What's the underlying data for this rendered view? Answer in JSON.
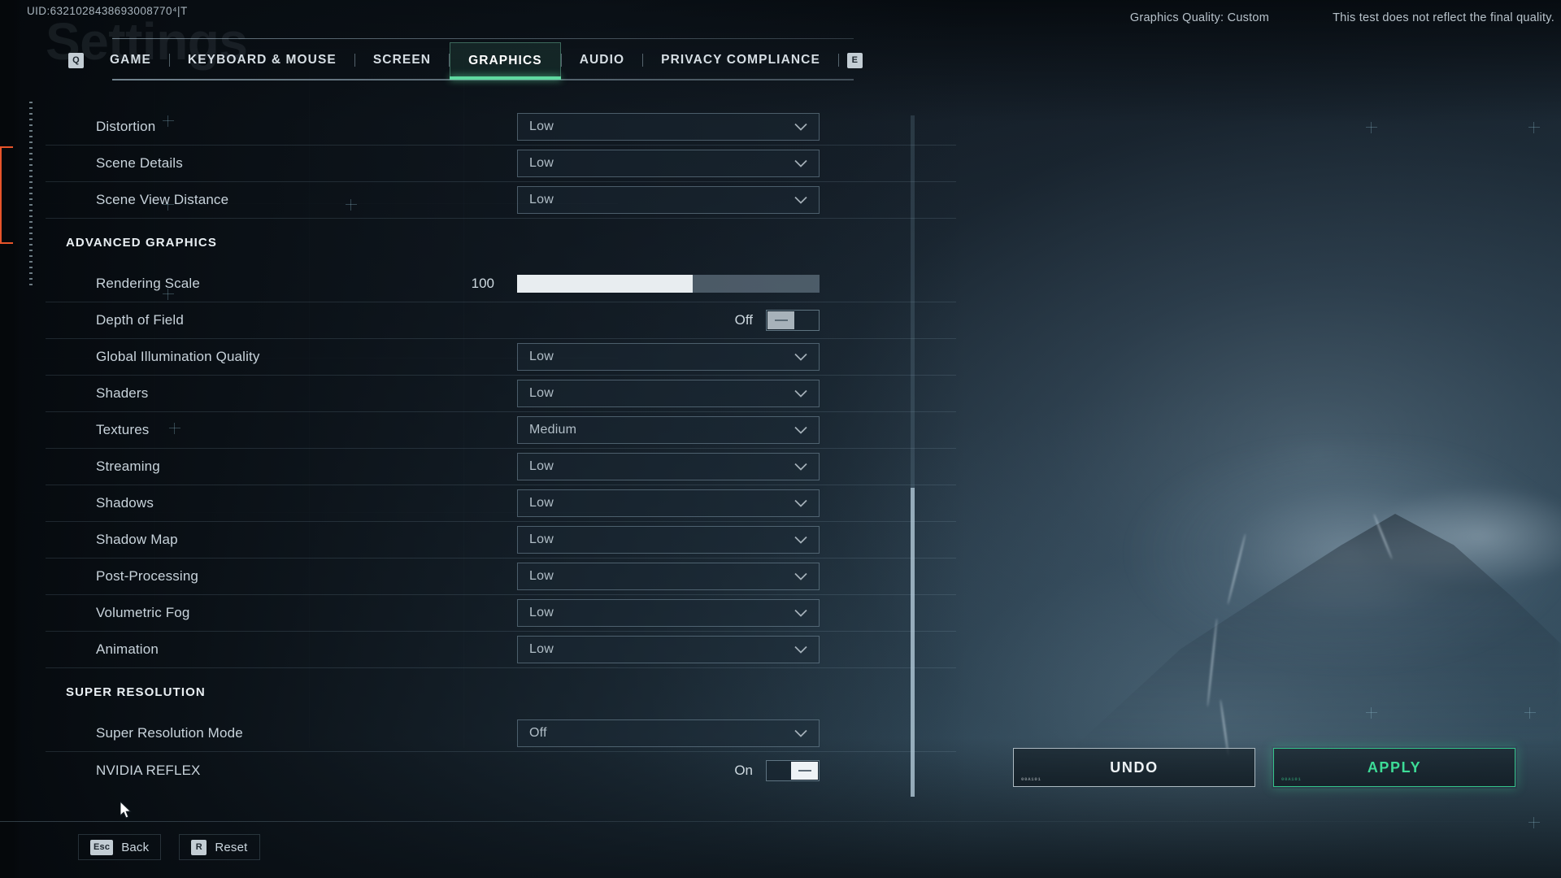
{
  "header": {
    "uid": "UID:6321028438693008770⁴|T",
    "ghost_title": "Settings",
    "graphics_quality": "Graphics Quality: Custom",
    "test_note": "This test does not reflect the final quality."
  },
  "tabs": {
    "prev_key": "Q",
    "next_key": "E",
    "items": [
      {
        "label": "GAME",
        "active": false
      },
      {
        "label": "KEYBOARD & MOUSE",
        "active": false
      },
      {
        "label": "SCREEN",
        "active": false
      },
      {
        "label": "GRAPHICS",
        "active": true
      },
      {
        "label": "AUDIO",
        "active": false
      },
      {
        "label": "PRIVACY COMPLIANCE",
        "active": false
      }
    ]
  },
  "settings": [
    {
      "kind": "dropdown",
      "label": "Distortion",
      "value": "Low"
    },
    {
      "kind": "dropdown",
      "label": "Scene Details",
      "value": "Low"
    },
    {
      "kind": "dropdown",
      "label": "Scene View Distance",
      "value": "Low"
    },
    {
      "kind": "section",
      "label": "ADVANCED GRAPHICS"
    },
    {
      "kind": "slider",
      "label": "Rendering Scale",
      "value": "100",
      "fill_percent": 58
    },
    {
      "kind": "toggle",
      "label": "Depth of Field",
      "state": "Off",
      "on": false
    },
    {
      "kind": "dropdown",
      "label": "Global Illumination Quality",
      "value": "Low"
    },
    {
      "kind": "dropdown",
      "label": "Shaders",
      "value": "Low"
    },
    {
      "kind": "dropdown",
      "label": "Textures",
      "value": "Medium"
    },
    {
      "kind": "dropdown",
      "label": "Streaming",
      "value": "Low"
    },
    {
      "kind": "dropdown",
      "label": "Shadows",
      "value": "Low"
    },
    {
      "kind": "dropdown",
      "label": "Shadow Map",
      "value": "Low"
    },
    {
      "kind": "dropdown",
      "label": "Post-Processing",
      "value": "Low"
    },
    {
      "kind": "dropdown",
      "label": "Volumetric Fog",
      "value": "Low"
    },
    {
      "kind": "dropdown",
      "label": "Animation",
      "value": "Low"
    },
    {
      "kind": "section",
      "label": "SUPER RESOLUTION"
    },
    {
      "kind": "dropdown",
      "label": "Super Resolution Mode",
      "value": "Off"
    },
    {
      "kind": "toggle",
      "label": "NVIDIA REFLEX",
      "state": "On",
      "on": true
    }
  ],
  "actions": {
    "undo_label": "UNDO",
    "apply_label": "APPLY",
    "microtext": "00A101"
  },
  "footer": {
    "back_key": "Esc",
    "back_label": "Back",
    "reset_key": "R",
    "reset_label": "Reset"
  },
  "colors": {
    "accent_green": "#3ddc97",
    "accent_orange": "#e8542a",
    "text_primary": "#e9eff3",
    "text_muted": "#b2bfc8"
  }
}
